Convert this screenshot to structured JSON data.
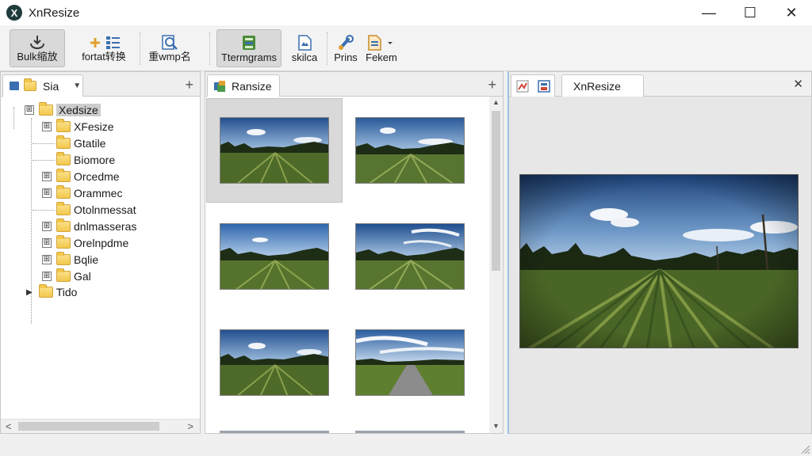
{
  "window": {
    "title": "XnResize",
    "app_icon_glyph": "X",
    "controls": {
      "minimize": "—",
      "maximize": "☐",
      "close": "✕"
    }
  },
  "toolbar": {
    "buttons": [
      {
        "label": "Bulk缩放",
        "icon": "bulk-resize-icon",
        "active": true
      },
      {
        "label": "fortat转换",
        "icon": "format-convert-icon",
        "active": false
      },
      {
        "label": "重wmp名",
        "icon": "rename-icon",
        "active": false
      },
      {
        "label": "Ttermgrams",
        "icon": "template-icon",
        "active": true
      },
      {
        "label": "skilca",
        "icon": "document-icon",
        "active": false
      },
      {
        "label": "Prins",
        "icon": "link-icon",
        "active": false
      },
      {
        "label": "Fekem",
        "icon": "file-menu-icon",
        "active": false
      }
    ]
  },
  "left_panel": {
    "tab_label": "Sia",
    "dropdown_glyph": "▼",
    "add_glyph": "+",
    "tree": [
      {
        "label": "Xedsize",
        "level": 0,
        "expander": "⊞",
        "selected": true
      },
      {
        "label": "XFesize",
        "level": 1,
        "expander": "⊞",
        "selected": false
      },
      {
        "label": "Gtatile",
        "level": 1,
        "expander": "",
        "selected": false
      },
      {
        "label": "Biomore",
        "level": 1,
        "expander": "",
        "selected": false
      },
      {
        "label": "Orcedme",
        "level": 1,
        "expander": "⊞",
        "selected": false
      },
      {
        "label": "Orammec",
        "level": 1,
        "expander": "⊞",
        "selected": false
      },
      {
        "label": "Otolnmessat",
        "level": 1,
        "expander": "",
        "selected": false
      },
      {
        "label": "dnlmasseras",
        "level": 1,
        "expander": "⊞",
        "selected": false
      },
      {
        "label": "Orelnpdme",
        "level": 1,
        "expander": "⊞",
        "selected": false
      },
      {
        "label": "Bqlie",
        "level": 1,
        "expander": "⊞",
        "selected": false
      },
      {
        "label": "Gal",
        "level": 1,
        "expander": "⊞",
        "selected": false
      },
      {
        "label": "Tido",
        "level": 0,
        "expander": "▶",
        "selected": false
      }
    ],
    "scroll_left": "<",
    "scroll_right": ">"
  },
  "middle_panel": {
    "tab_label": "Ransize",
    "add_glyph": "+",
    "thumbnails": [
      {
        "scene": "field-cloudy",
        "selected": true
      },
      {
        "scene": "field-cloudy",
        "selected": false
      },
      {
        "scene": "field-clear",
        "selected": false
      },
      {
        "scene": "field-wispy",
        "selected": false
      },
      {
        "scene": "field-cloudy",
        "selected": false
      },
      {
        "scene": "road",
        "selected": false
      }
    ],
    "scroll_up": "▲",
    "scroll_down": "▼"
  },
  "right_panel": {
    "tab_label": "XnResize",
    "close_glyph": "✕",
    "icons": [
      "image-tab-icon",
      "save-icon"
    ]
  },
  "colors": {
    "sky_top": "#2f5d9a",
    "sky_bottom": "#9cc0e4",
    "grass_dark": "#2e4419",
    "grass_light": "#6f8c3b",
    "tree": "#1e2d15"
  }
}
